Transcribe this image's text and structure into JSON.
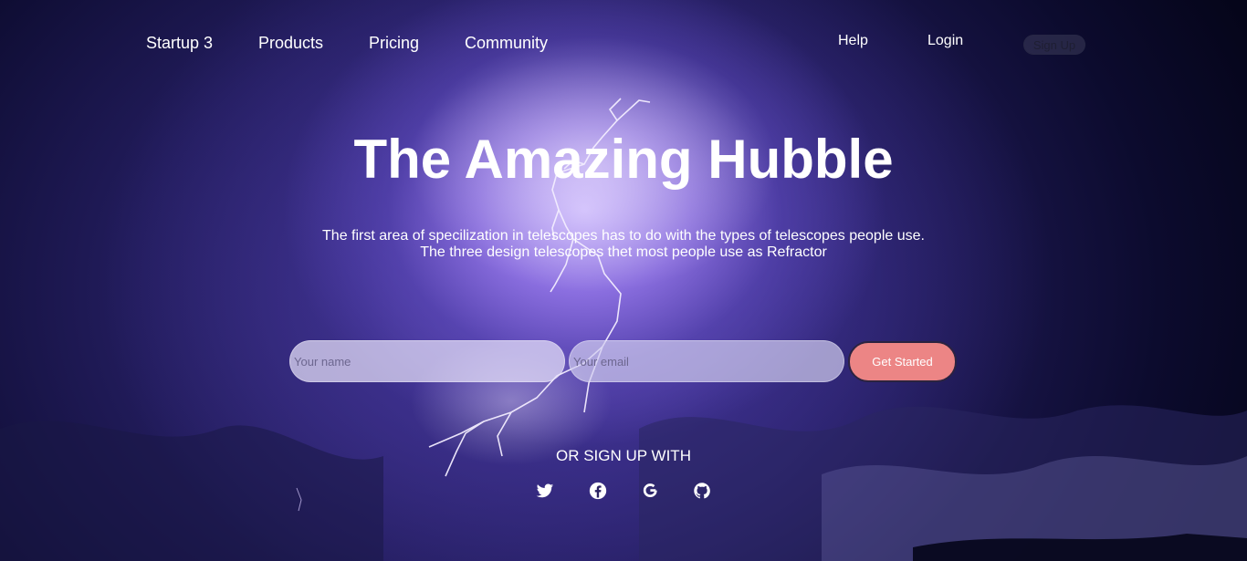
{
  "nav": {
    "brand": "Startup 3",
    "links": [
      "Products",
      "Pricing",
      "Community"
    ],
    "help": "Help",
    "login": "Login",
    "signup": "Sign Up"
  },
  "hero": {
    "title": "The Amazing Hubble",
    "subtitle_line1": "The first area of specilization in telescopes has to do with the types of telescopes people use.",
    "subtitle_line2": "The three design telescopes thet most people use as Refractor"
  },
  "form": {
    "name_placeholder": "Your name",
    "email_placeholder": "Your email",
    "submit_label": "Get Started"
  },
  "social": {
    "heading": "OR SIGN UP WITH",
    "icons": [
      "twitter-icon",
      "facebook-icon",
      "google-icon",
      "github-icon"
    ]
  },
  "colors": {
    "button_accent": "#ec8585",
    "text": "#ffffff",
    "sky_dark": "#0c0b2e",
    "sky_glow": "#cdb9ff"
  }
}
